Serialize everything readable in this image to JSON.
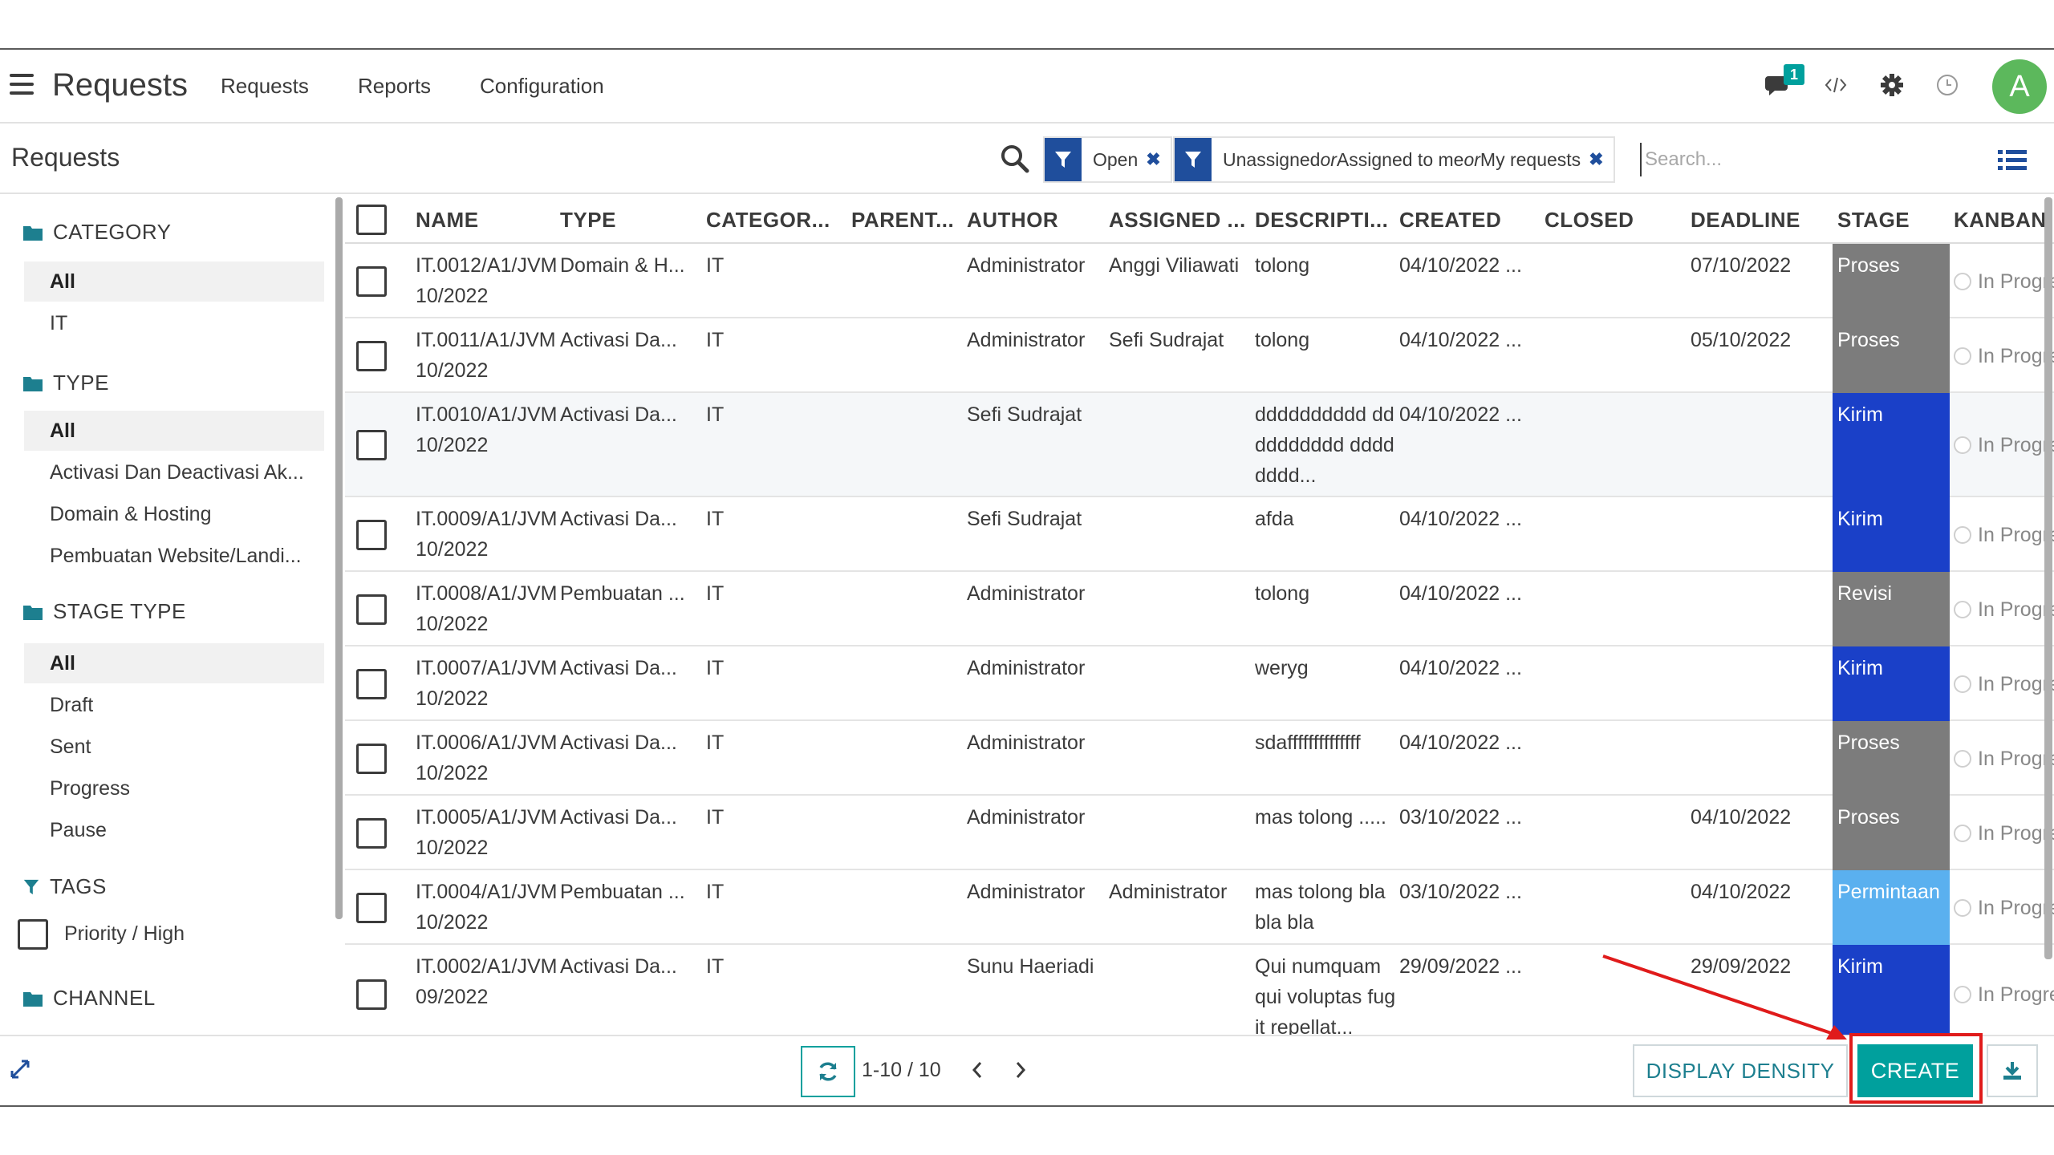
{
  "navbar": {
    "app_title": "Requests",
    "menus": [
      "Requests",
      "Reports",
      "Configuration"
    ],
    "notification_count": "1",
    "avatar_letter": "A",
    "icons": [
      "hamburger-icon",
      "chat-icon",
      "code-icon",
      "gear-icon",
      "clock-icon"
    ]
  },
  "control": {
    "breadcrumb": "Requests",
    "facets": [
      {
        "text": "Open"
      },
      {
        "parts": [
          "Unassigned",
          " or ",
          "Assigned to me",
          " or ",
          "My requests"
        ]
      }
    ],
    "search_placeholder": "Search..."
  },
  "sidebar": {
    "category": {
      "title": "CATEGORY",
      "items": [
        "All",
        "IT"
      ]
    },
    "type": {
      "title": "TYPE",
      "items": [
        "All",
        "Activasi Dan Deactivasi Ak...",
        "Domain & Hosting",
        "Pembuatan Website/Landi..."
      ]
    },
    "stage_type": {
      "title": "STAGE TYPE",
      "items": [
        "All",
        "Draft",
        "Sent",
        "Progress",
        "Pause"
      ]
    },
    "tags": {
      "title": "TAGS",
      "items": [
        "Priority / High"
      ]
    },
    "channel": {
      "title": "CHANNEL"
    }
  },
  "table": {
    "columns": [
      "NAME",
      "TYPE",
      "CATEGOR...",
      "PARENT...",
      "AUTHOR",
      "ASSIGNED ...",
      "DESCRIPTI...",
      "CREATED",
      "CLOSED",
      "DEADLINE",
      "STAGE",
      "KANBAN"
    ],
    "rows": [
      {
        "name1": "IT.0012/A1/JVM",
        "name2": "10/2022",
        "type": "Domain & H...",
        "category": "IT",
        "author": "Administrator",
        "assigned": "Anggi Viliawati",
        "description": "tolong",
        "created": "04/10/2022 ...",
        "closed": "",
        "deadline": "07/10/2022",
        "stage": "Proses",
        "kanban": "In Progress"
      },
      {
        "name1": "IT.0011/A1/JVM",
        "name2": "10/2022",
        "type": "Activasi Da...",
        "category": "IT",
        "author": "Administrator",
        "assigned": "Sefi Sudrajat",
        "description": "tolong",
        "created": "04/10/2022 ...",
        "closed": "",
        "deadline": "05/10/2022",
        "stage": "Proses",
        "kanban": "In Progress"
      },
      {
        "name1": "IT.0010/A1/JVM",
        "name2": "10/2022",
        "type": "Activasi Da...",
        "category": "IT",
        "author": "Sefi Sudrajat",
        "assigned": "",
        "description": "dddddddddd dddddddddd dddddddd...",
        "created": "04/10/2022 ...",
        "closed": "",
        "deadline": "",
        "stage": "Kirim",
        "kanban": "In Progress"
      },
      {
        "name1": "IT.0009/A1/JVM",
        "name2": "10/2022",
        "type": "Activasi Da...",
        "category": "IT",
        "author": "Sefi Sudrajat",
        "assigned": "",
        "description": "afda",
        "created": "04/10/2022 ...",
        "closed": "",
        "deadline": "",
        "stage": "Kirim",
        "kanban": "In Progress"
      },
      {
        "name1": "IT.0008/A1/JVM",
        "name2": "10/2022",
        "type": "Pembuatan ...",
        "category": "IT",
        "author": "Administrator",
        "assigned": "",
        "description": "tolong",
        "created": "04/10/2022 ...",
        "closed": "",
        "deadline": "",
        "stage": "Revisi",
        "kanban": "In Progress"
      },
      {
        "name1": "IT.0007/A1/JVM",
        "name2": "10/2022",
        "type": "Activasi Da...",
        "category": "IT",
        "author": "Administrator",
        "assigned": "",
        "description": "weryg",
        "created": "04/10/2022 ...",
        "closed": "",
        "deadline": "",
        "stage": "Kirim",
        "kanban": "In Progress"
      },
      {
        "name1": "IT.0006/A1/JVM",
        "name2": "10/2022",
        "type": "Activasi Da...",
        "category": "IT",
        "author": "Administrator",
        "assigned": "",
        "description": "sdaffffffffffffff",
        "created": "04/10/2022 ...",
        "closed": "",
        "deadline": "",
        "stage": "Proses",
        "kanban": "In Progress"
      },
      {
        "name1": "IT.0005/A1/JVM",
        "name2": "10/2022",
        "type": "Activasi Da...",
        "category": "IT",
        "author": "Administrator",
        "assigned": "",
        "description": "mas tolong .....",
        "created": "03/10/2022 ...",
        "closed": "",
        "deadline": "04/10/2022",
        "stage": "Proses",
        "kanban": "In Progress"
      },
      {
        "name1": "IT.0004/A1/JVM",
        "name2": "10/2022",
        "type": "Pembuatan ...",
        "category": "IT",
        "author": "Administrator",
        "assigned": "Administrator",
        "description": "mas tolong bla bla bla",
        "created": "03/10/2022 ...",
        "closed": "",
        "deadline": "04/10/2022",
        "stage": "Permintaan",
        "kanban": "In Progress"
      },
      {
        "name1": "IT.0002/A1/JVM",
        "name2": "09/2022",
        "type": "Activasi Da...",
        "category": "IT",
        "author": "Sunu Haeriadi",
        "assigned": "",
        "description": "Qui numquam qui voluptas fugit repellat...",
        "created": "29/09/2022 ...",
        "closed": "",
        "deadline": "29/09/2022",
        "stage": "Kirim",
        "kanban": "In Progress"
      }
    ]
  },
  "stage_colors": {
    "Proses": "#7c7c7c",
    "Kirim": "#1a40c8",
    "Revisi": "#7c7c7c",
    "Permintaan": "#5ab0ef"
  },
  "footer": {
    "pager": "1-10 / 10",
    "density_label": "DISPLAY DENSITY",
    "create_label": "CREATE"
  },
  "colors": {
    "accent": "#00a09d",
    "facet": "#1f4e9c",
    "annotation": "#e01b1b"
  }
}
